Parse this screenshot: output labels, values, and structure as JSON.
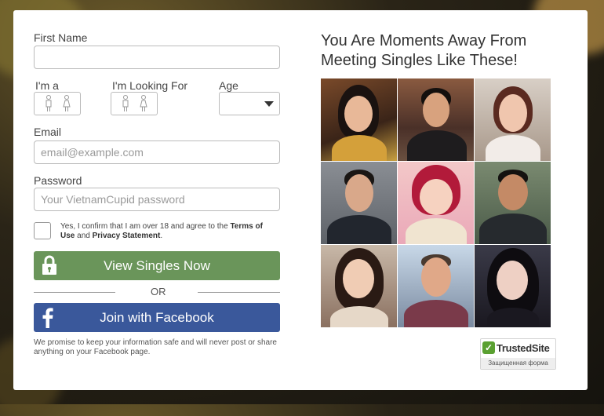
{
  "form": {
    "first_name_label": "First Name",
    "first_name_value": "",
    "im_a_label": "I'm a",
    "looking_for_label": "I'm Looking For",
    "age_label": "Age",
    "age_value": "",
    "email_label": "Email",
    "email_placeholder": "email@example.com",
    "password_label": "Password",
    "password_placeholder": "Your VietnamCupid password",
    "terms_prefix": "Yes, I confirm that I am over 18 and agree to the",
    "terms_link": "Terms of Use",
    "terms_and": "and",
    "privacy_link": "Privacy Statement",
    "terms_suffix": ".",
    "view_singles_label": "View Singles Now",
    "or_label": "OR",
    "facebook_label": "Join with Facebook",
    "promise_text": "We promise to keep your information safe and will never post or share anything on your Facebook page."
  },
  "promo": {
    "headline_line1": "You Are Moments Away From",
    "headline_line2": "Meeting Singles Like These!"
  },
  "trusted_site": {
    "name": "TrustedSite",
    "subtitle": "Защищенная форма"
  },
  "colors": {
    "view_button": "#6a955a",
    "facebook_button": "#3a589b",
    "trusted_green": "#5aa031"
  },
  "icons": {
    "lock": "lock-icon",
    "facebook": "facebook-icon",
    "male": "male-icon",
    "female": "female-icon",
    "caret": "chevron-down-icon",
    "trusted": "checkmark-icon"
  }
}
